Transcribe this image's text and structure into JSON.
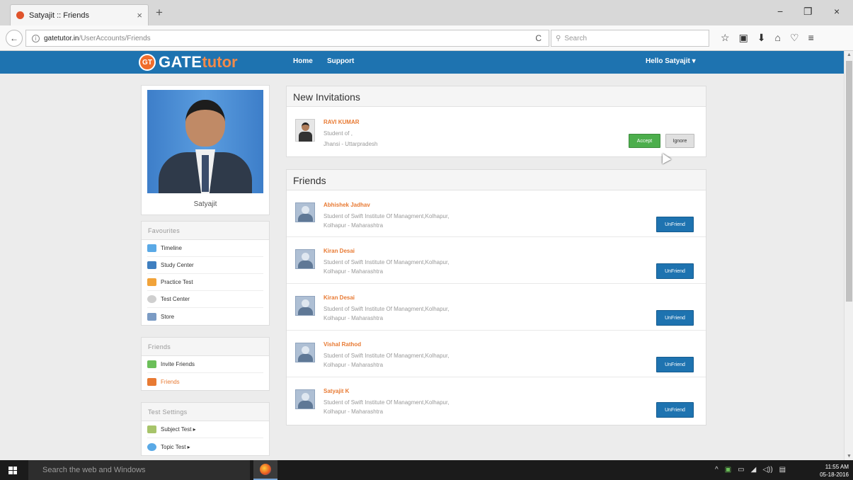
{
  "browser": {
    "tab_title": "Satyajit :: Friends",
    "tab_close": "×",
    "new_tab": "+",
    "win_minimize": "−",
    "win_restore": "❐",
    "win_close": "×",
    "back": "←",
    "url_host": "gatetutor.in",
    "url_path": "/UserAccounts/Friends",
    "reload": "C",
    "search_placeholder": "Search",
    "toolbar_icons": [
      "☆",
      "▣",
      "⬇",
      "⌂",
      "♡",
      "≡"
    ]
  },
  "site": {
    "logo_badge": "GT",
    "logo_gate": "GATE",
    "logo_tutor": "tutor",
    "nav_home": "Home",
    "nav_support": "Support",
    "user_menu": "Hello Satyajit ▾"
  },
  "profile": {
    "name": "Satyajit"
  },
  "sidebar": {
    "favourites_title": "Favourites",
    "favourites": [
      {
        "label": "Timeline",
        "color": "#5aa9e6"
      },
      {
        "label": "Study Center",
        "color": "#3f7fc0"
      },
      {
        "label": "Practice Test",
        "color": "#f1a33a"
      },
      {
        "label": "Test Center",
        "color": "#cfcfcf"
      },
      {
        "label": "Store",
        "color": "#7b9bc4"
      }
    ],
    "friends_title": "Friends",
    "friends": [
      {
        "label": "Invite Friends",
        "color": "#6bbf59"
      },
      {
        "label": "Friends",
        "color": "#e87a33"
      }
    ],
    "test_settings_title": "Test Settings",
    "test_settings": [
      {
        "label": "Subject Test ▸",
        "color": "#a7c46a"
      },
      {
        "label": "Topic Test ▸",
        "color": "#5aa9e6"
      }
    ]
  },
  "invitations": {
    "title": "New Invitations",
    "items": [
      {
        "name": "RAVI KUMAR",
        "line1": "Student of ,",
        "line2": "Jhansi - Uttarpradesh",
        "accept_label": "Accept",
        "ignore_label": "Ignore"
      }
    ]
  },
  "friends": {
    "title": "Friends",
    "unfriend_label": "UnFriend",
    "items": [
      {
        "name": "Abhishek Jadhav",
        "line1": "Student of Swift Institute Of Managment,Kolhapur,",
        "line2": "Kolhapur - Maharashtra"
      },
      {
        "name": "Kiran Desai",
        "line1": "Student of Swift Institute Of Managment,Kolhapur,",
        "line2": "Kolhapur - Maharashtra"
      },
      {
        "name": "Kiran Desai",
        "line1": "Student of Swift Institute Of Managment,Kolhapur,",
        "line2": "Kolhapur - Maharashtra"
      },
      {
        "name": "Vishal Rathod",
        "line1": "Student of Swift Institute Of Managment,Kolhapur,",
        "line2": "Kolhapur - Maharashtra"
      },
      {
        "name": "Satyajit K",
        "line1": "Student of Swift Institute Of Managment,Kolhapur,",
        "line2": "Kolhapur - Maharashtra"
      }
    ]
  },
  "taskbar": {
    "search_placeholder": "Search the web and Windows",
    "tray_icons": [
      "^",
      "▣",
      "▭",
      "◢",
      "◁))",
      "▤"
    ],
    "time": "11:55 AM",
    "date": "05-18-2016"
  },
  "colors": {
    "brand_blue": "#1e73b0",
    "accent_orange": "#e87a33",
    "accept_green": "#4cae4c"
  }
}
